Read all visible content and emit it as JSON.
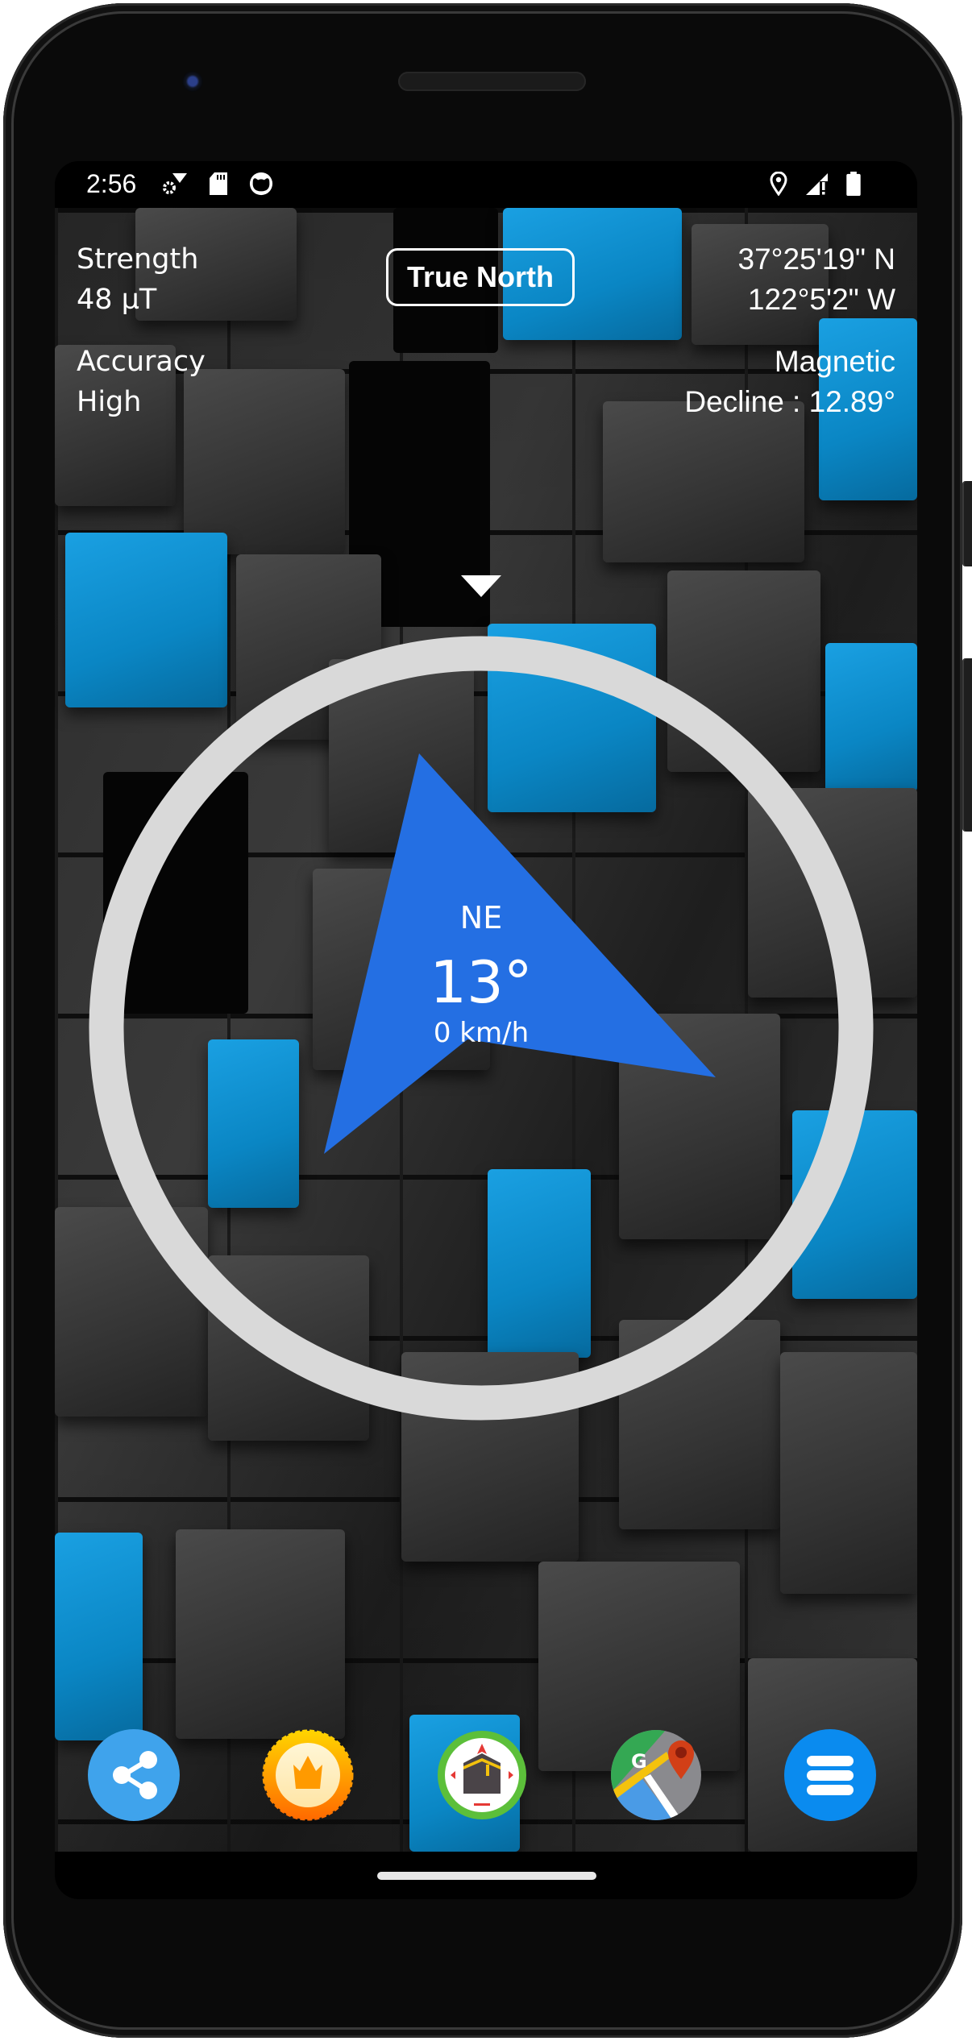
{
  "status_bar": {
    "time": "2:56",
    "left_icons": [
      "settings-wifi-icon",
      "sd-card-icon",
      "android-cat-icon"
    ],
    "right_icons": [
      "location-pin-icon",
      "signal-alert-icon",
      "battery-icon"
    ]
  },
  "readouts": {
    "strength_label": "Strength",
    "strength_value": "48 µT",
    "accuracy_label": "Accuracy",
    "accuracy_value": "High",
    "latitude": "37°25'19\" N",
    "longitude": "122°5'2\" W",
    "declination_label": "Magnetic",
    "declination_value": "Decline : 12.89°"
  },
  "north_toggle": {
    "label": "True North"
  },
  "compass": {
    "direction": "NE",
    "heading": "13°",
    "heading_degrees": 13,
    "speed": "0 km/h",
    "ring_color": "#d9d9d9",
    "arrow_color": "#246fe3"
  },
  "dock": [
    {
      "name": "share",
      "icon": "share-icon",
      "color": "#3fa3ec"
    },
    {
      "name": "premium",
      "icon": "crown-badge-icon",
      "color": "#ff9800"
    },
    {
      "name": "qibla",
      "icon": "kaaba-compass-icon",
      "color": "#5cbf3a"
    },
    {
      "name": "maps",
      "icon": "google-maps-icon",
      "color": "#34a853"
    },
    {
      "name": "menu",
      "icon": "menu-icon",
      "color": "#0a8bef"
    }
  ]
}
